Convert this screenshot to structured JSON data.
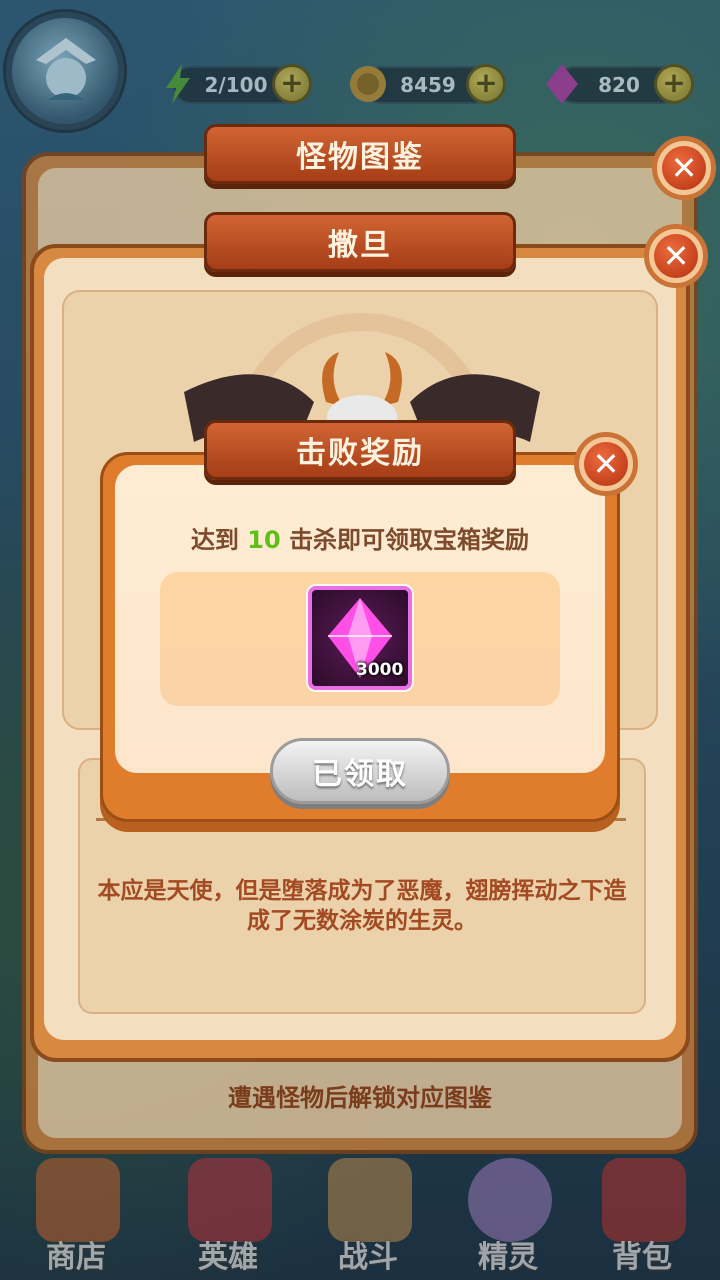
{
  "resources": {
    "energy": "2/100",
    "gold": "8459",
    "gems": "820"
  },
  "monster_guide": {
    "title": "怪物图鉴",
    "hint": "遭遇怪物后解锁对应图鉴"
  },
  "monster": {
    "name": "撒旦",
    "description": "本应是天使，但是堕落成为了恶魔，翅膀挥动之下造成了无数涂炭的生灵。"
  },
  "reward_popup": {
    "title": "击败奖励",
    "goal_prefix": "达到",
    "goal_count": "10",
    "goal_suffix": "击杀即可领取宝箱奖励",
    "item_count": "3000",
    "claim_button": "已领取"
  },
  "nav": {
    "items": [
      {
        "label": "商店"
      },
      {
        "label": "英雄"
      },
      {
        "label": "战斗"
      },
      {
        "label": "精灵"
      },
      {
        "label": "背包"
      }
    ]
  },
  "colors": {
    "panel_orange": "#d78841",
    "tab_red": "#b4461d",
    "goal_green": "#5fbf1a",
    "gem_magenta": "#e86fe6"
  }
}
